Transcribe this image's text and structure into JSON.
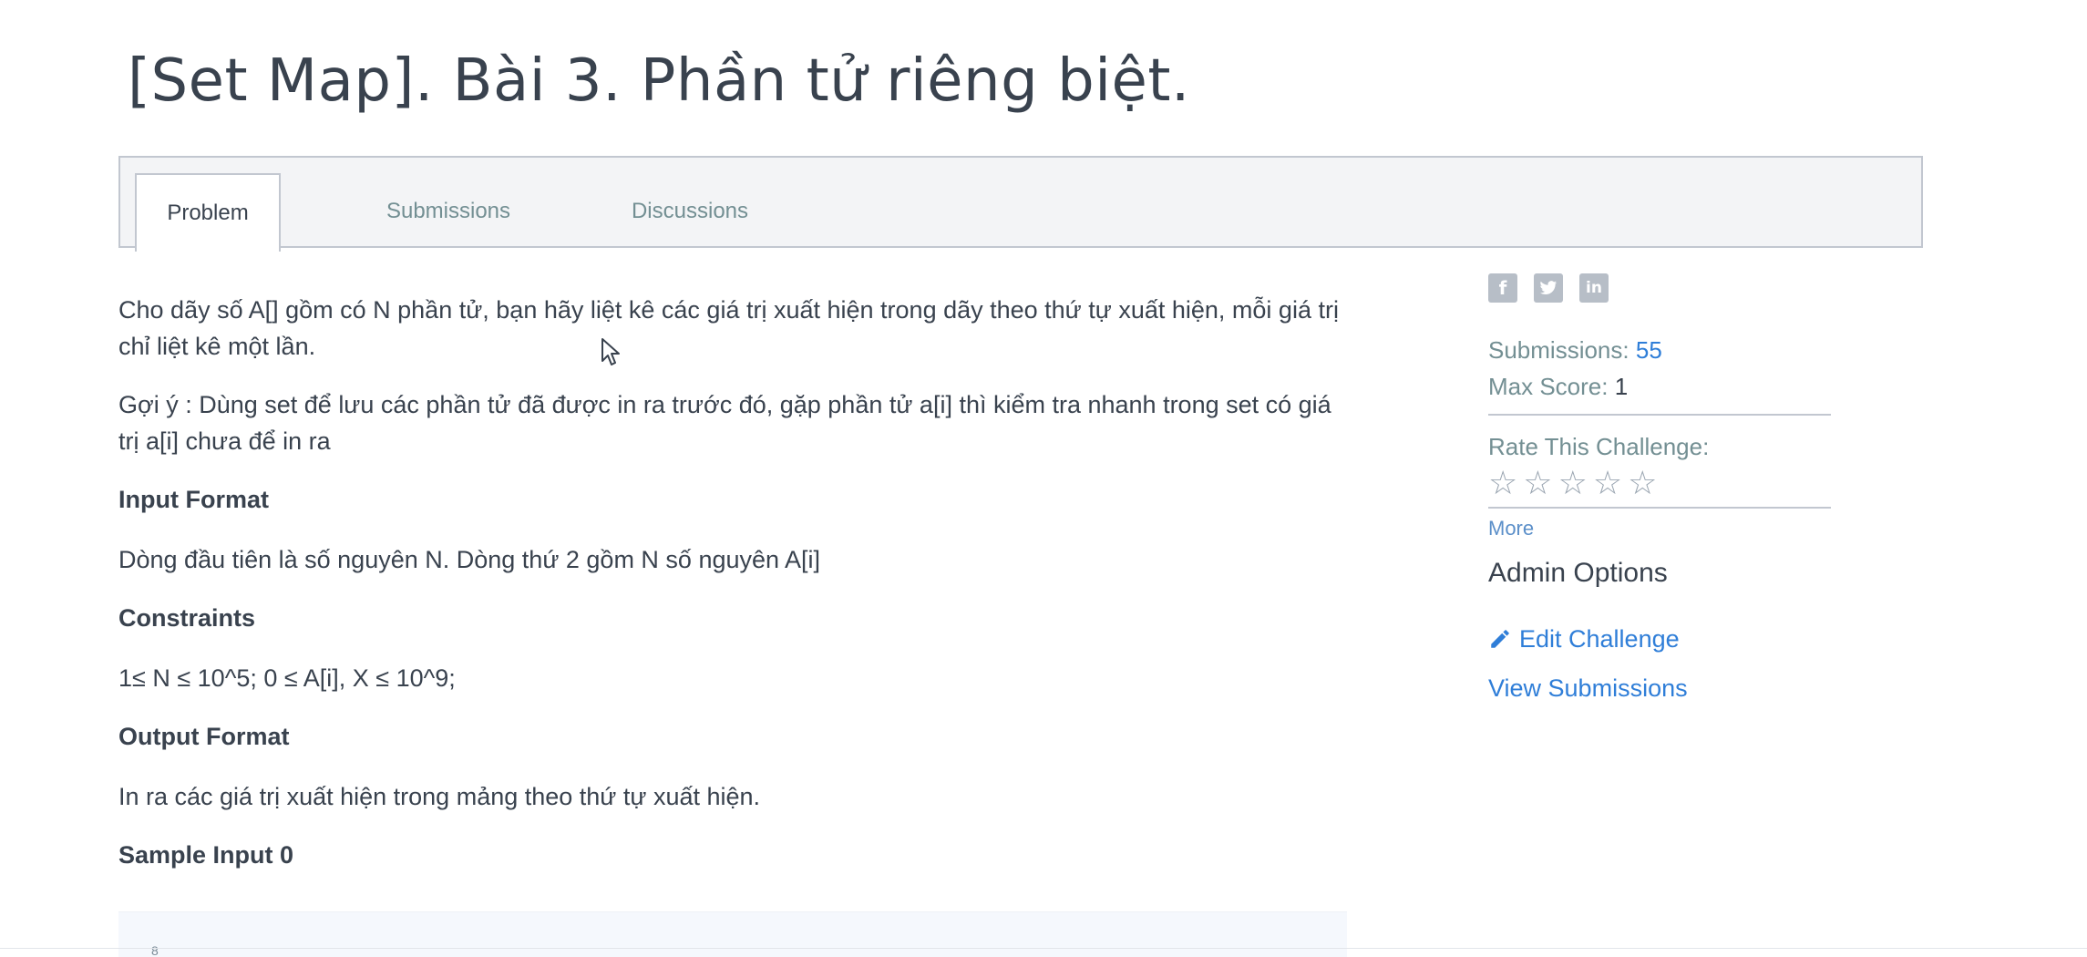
{
  "page": {
    "title": "[Set Map]. Bài 3. Phần tử riêng biệt."
  },
  "tabs": [
    {
      "label": "Problem",
      "active": true
    },
    {
      "label": "Submissions",
      "active": false
    },
    {
      "label": "Discussions",
      "active": false
    }
  ],
  "problem": {
    "statement": "Cho dãy số A[] gồm có N phần tử, bạn hãy liệt kê các giá trị xuất hiện trong dãy theo thứ tự xuất hiện, mỗi giá trị chỉ liệt kê một lần.",
    "hint": "Gợi ý : Dùng set để lưu các phần tử đã được in ra trước đó, gặp phần tử a[i] thì kiểm tra nhanh trong set có giá trị a[i] chưa để in ra",
    "input_format_heading": "Input Format",
    "input_format": "Dòng đầu tiên là số nguyên N. Dòng thứ 2 gồm N số nguyên A[i]",
    "constraints_heading": "Constraints",
    "constraints": "1≤ N ≤ 10^5; 0 ≤ A[i], X ≤ 10^9;",
    "output_format_heading": "Output Format",
    "output_format": "In ra các giá trị xuất hiện trong mảng theo thứ tự xuất hiện.",
    "sample_input_heading": "Sample Input 0",
    "sample_input_line": "8"
  },
  "sidebar": {
    "social_icons": [
      "facebook-icon",
      "twitter-icon",
      "linkedin-icon"
    ],
    "submissions_label": "Submissions:",
    "submissions_value": "55",
    "max_score_label": "Max Score:",
    "max_score_value": "1",
    "rate_label": "Rate This Challenge:",
    "rating_stars": 5,
    "rating_value": 0,
    "more_label": "More",
    "admin_title": "Admin Options",
    "edit_challenge": "Edit Challenge",
    "view_submissions": "View Submissions"
  },
  "colors": {
    "text": "#39424e",
    "muted": "#738f93",
    "link": "#2f7ed8",
    "border": "#c2c7d0"
  }
}
